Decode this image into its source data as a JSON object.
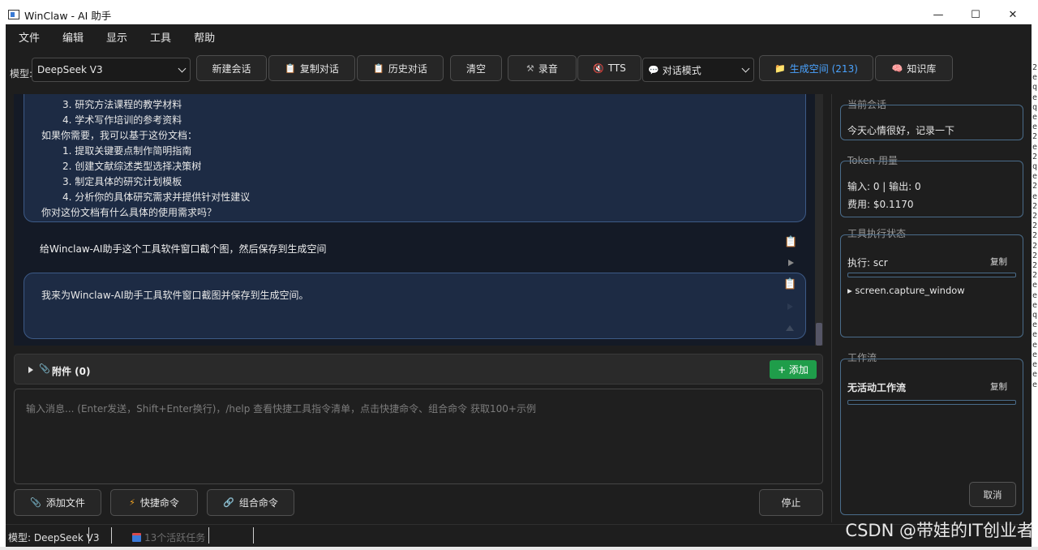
{
  "window": {
    "title": "WinClaw - AI 助手",
    "controls": [
      "—",
      "☐",
      "✕"
    ]
  },
  "menu": [
    "文件",
    "编辑",
    "显示",
    "工具",
    "帮助"
  ],
  "toolbar": {
    "model_label": "模型:",
    "model_value": "DeepSeek V3",
    "new_chat": "新建会话",
    "copy_chat": "复制对话",
    "history": "历史对话",
    "clear": "清空",
    "record": "录音",
    "tts": "TTS",
    "mode_value": "对话模式",
    "gen_space": "生成空间 (213)",
    "knowledge": "知识库",
    "accent_color": "#4aa3ff"
  },
  "chat": {
    "assistant_prev_lines": [
      "3. 研究方法课程的教学材料",
      "4. 学术写作培训的参考资料",
      "如果你需要，我可以基于这份文档：",
      "1. 提取关键要点制作简明指南",
      "2. 创建文献综述类型选择决策树",
      "3. 制定具体的研究计划模板",
      "4. 分析你的具体研究需求并提供针对性建议",
      "你对这份文档有什么具体的使用需求吗？"
    ],
    "user_message": "给Winclaw-AI助手这个工具软件窗口截个图，然后保存到生成空间",
    "assistant_reply": "我来为Winclaw-AI助手工具软件窗口截图并保存到生成空间。"
  },
  "attachments": {
    "label": "附件 (0)",
    "add": "+ 添加",
    "add_color": "#1f9d4a"
  },
  "input": {
    "placeholder": "输入消息... (Enter发送，Shift+Enter换行)，/help 查看快捷工具指令清单，点击快捷命令、组合命令 获取100+示例"
  },
  "bottom_buttons": {
    "add_file": "添加文件",
    "quick_cmd": "快捷命令",
    "combo_cmd": "组合命令",
    "stop": "停止"
  },
  "right_panel": {
    "current_session_title": "当前会话",
    "current_session_value": "今天心情很好，记录一下",
    "token_title": "Token 用量",
    "token_io": "输入: 0 | 输出: 0",
    "token_cost": "费用: $0.1170",
    "tool_status_title": "工具执行状态",
    "tool_exec": "执行: scr",
    "tool_copy": "复制",
    "tool_item": "▸ screen.capture_window",
    "workflow_title": "工作流",
    "workflow_value": "无活动工作流",
    "workflow_copy": "复制",
    "cancel": "取消"
  },
  "status": {
    "model": "模型: DeepSeek V3",
    "tasks": "13个活跃任务"
  },
  "watermark": "CSDN @带娃的IT创业者",
  "strip_text": "2\ne\nq\ne\nq\ne\ne\n2\ne\n2\nq\ne\n2\ne\n2\n2\n2\n2\n2\n2\n2\n2\ne\ne\ne\nq\ne\ne\ne\ne\ne\ne\ne"
}
